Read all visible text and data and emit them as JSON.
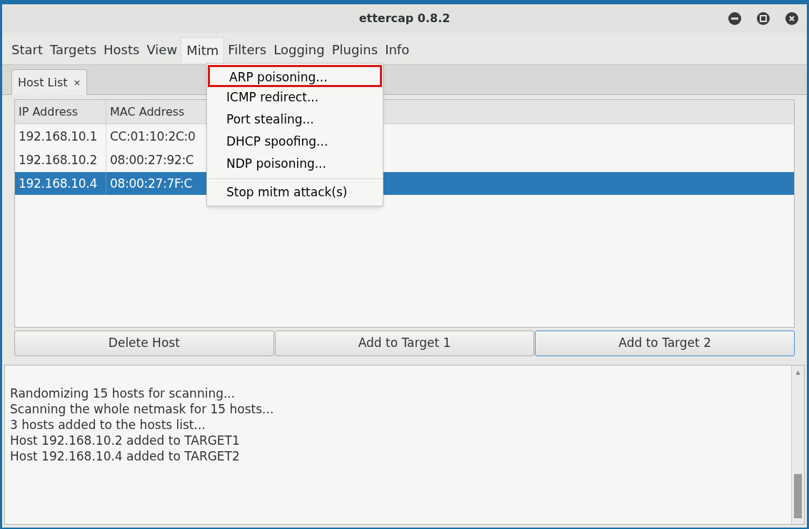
{
  "window": {
    "title": "ettercap 0.8.2"
  },
  "menu_bar": [
    {
      "label": "Start",
      "selected": false
    },
    {
      "label": "Targets",
      "selected": false
    },
    {
      "label": "Hosts",
      "selected": false
    },
    {
      "label": "View",
      "selected": false
    },
    {
      "label": "Mitm",
      "selected": true
    },
    {
      "label": "Filters",
      "selected": false
    },
    {
      "label": "Logging",
      "selected": false
    },
    {
      "label": "Plugins",
      "selected": false
    },
    {
      "label": "Info",
      "selected": false
    }
  ],
  "tabs": [
    {
      "label": "Host List",
      "close": "×",
      "selected": true
    }
  ],
  "table": {
    "columns": [
      "IP Address",
      "MAC Address"
    ],
    "rows": [
      {
        "cells": [
          "192.168.10.1",
          "CC:01:10:2C:0"
        ],
        "selected": false
      },
      {
        "cells": [
          "192.168.10.2",
          "08:00:27:92:C"
        ],
        "selected": false
      },
      {
        "cells": [
          "192.168.10.4",
          "08:00:27:7F:C"
        ],
        "selected": true
      }
    ]
  },
  "buttons": [
    {
      "label": "Delete Host",
      "focused": false
    },
    {
      "label": "Add to Target 1",
      "focused": false
    },
    {
      "label": "Add to Target 2",
      "focused": true
    }
  ],
  "log": {
    "scroll_up": "▲",
    "lines": [
      "Randomizing 15 hosts for scanning...",
      "Scanning the whole netmask for 15 hosts...",
      "3 hosts added to the hosts list...",
      "Host 192.168.10.2 added to TARGET1",
      "Host 192.168.10.4 added to TARGET2"
    ]
  },
  "dropdown": {
    "items": [
      {
        "kind": "item",
        "label": "ARP poisoning...",
        "highlighted": true
      },
      {
        "kind": "item",
        "label": "ICMP redirect...",
        "highlighted": false
      },
      {
        "kind": "item",
        "label": "Port stealing...",
        "highlighted": false
      },
      {
        "kind": "item",
        "label": "DHCP spoofing...",
        "highlighted": false
      },
      {
        "kind": "item",
        "label": "NDP poisoning...",
        "highlighted": false
      },
      {
        "kind": "separator"
      },
      {
        "kind": "item",
        "label": "Stop mitm attack(s)",
        "highlighted": false
      }
    ]
  }
}
